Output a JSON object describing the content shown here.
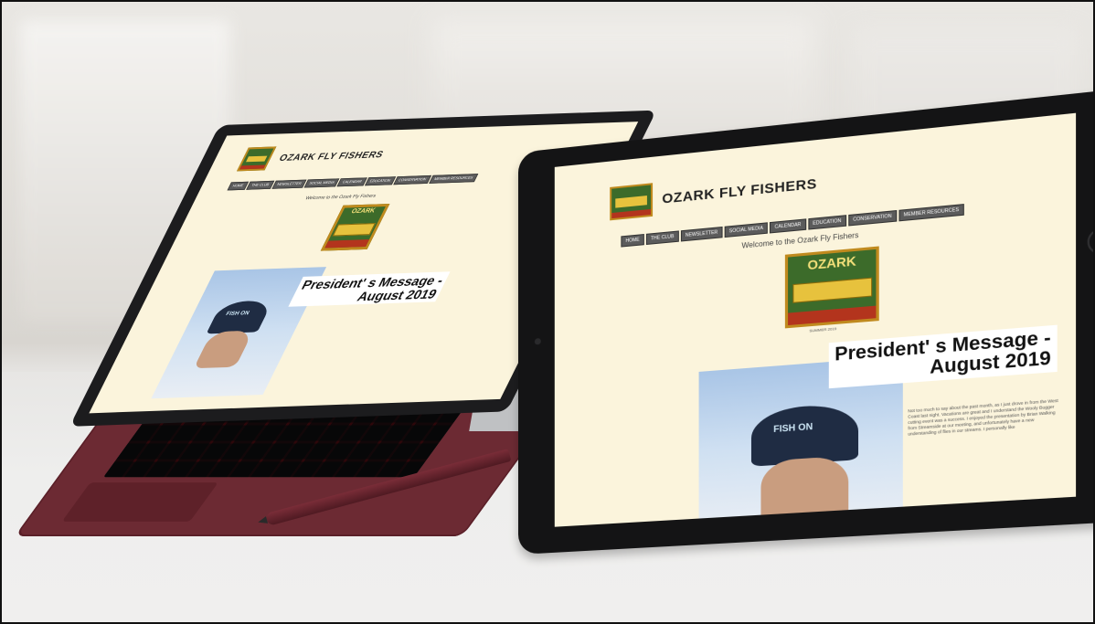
{
  "site": {
    "title": "OZARK FLY FISHERS",
    "nav": [
      "HOME",
      "THE CLUB",
      "NEWSLETTER",
      "SOCIAL MEDIA",
      "CALENDAR",
      "EDUCATION",
      "CONSERVATION",
      "MEMBER RESOURCES"
    ],
    "welcome": "Welcome to the Ozark Fly Fishers",
    "logo_text": "OZARK",
    "post_meta": "SUMMER 2019",
    "post_title_line1": "President' s Message -",
    "post_title_line2": "August 2019",
    "cap_text": "FISH ON",
    "body_text": "Not too much to say about the past month, as I just drove in from the West Coast last night. Vacations are great and I understand the Wooly Bugger cutting event was a success. I enjoyed the presentation by Brian Walking from Streamside at our meeting, and unfortunately have a new understanding of flies in our streams. I personally like"
  },
  "colors": {
    "page_bg": "#fbf4dc",
    "nav_bg": "#5b5b5b",
    "keyboard": "#6c2a33",
    "logo_green": "#3c6b2a",
    "logo_gold": "#e7c23d",
    "logo_red": "#b3341d"
  }
}
